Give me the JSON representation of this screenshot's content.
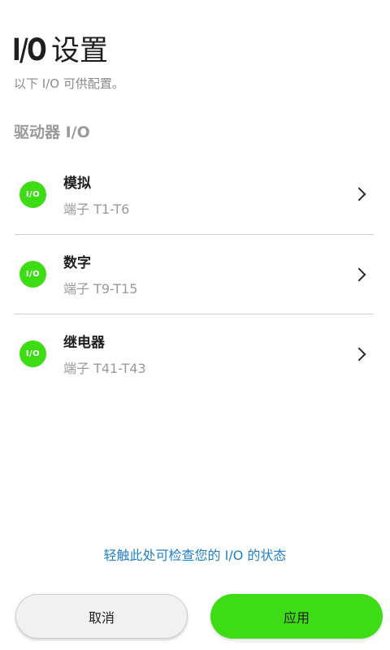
{
  "header": {
    "title_prefix": "I/O",
    "title_suffix": "设置",
    "subtitle": "以下 I/O 可供配置。"
  },
  "section": {
    "title": "驱动器 I/O"
  },
  "io_items": [
    {
      "badge": "I/O",
      "icon": "io-badge-icon",
      "name": "模拟",
      "desc": "端子 T1-T6"
    },
    {
      "badge": "I/O",
      "icon": "io-badge-icon",
      "name": "数字",
      "desc": "端子 T9-T15"
    },
    {
      "badge": "I/O",
      "icon": "io-badge-icon",
      "name": "继电器",
      "desc": "端子 T41-T43"
    }
  ],
  "footer": {
    "check_link": "轻触此处可检查您的 I/O 的状态",
    "cancel_label": "取消",
    "apply_label": "应用"
  },
  "colors": {
    "accent_green": "#3ddc14",
    "link_blue": "#1f7fc4",
    "secondary_text": "#9a9a9a"
  }
}
